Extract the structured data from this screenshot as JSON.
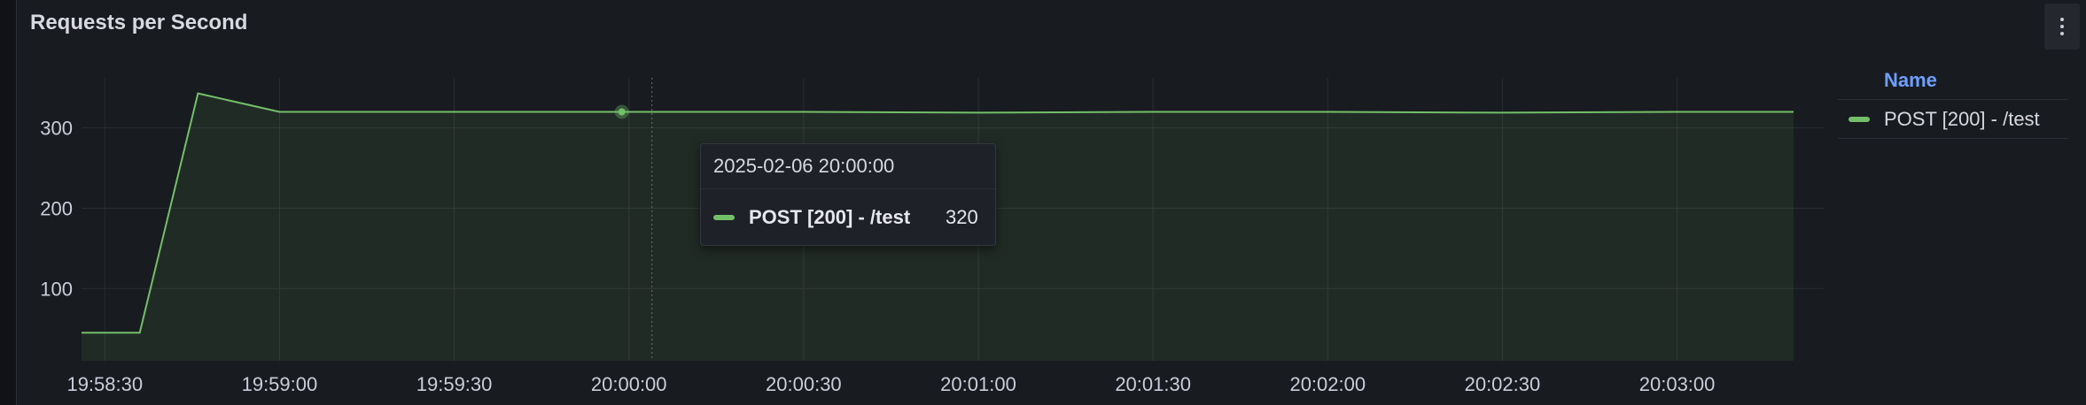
{
  "panel": {
    "title": "Requests per Second"
  },
  "legend": {
    "header": "Name",
    "items": [
      {
        "label": "POST [200] - /test",
        "color": "#73bf69"
      }
    ]
  },
  "tooltip": {
    "time": "2025-02-06 20:00:00",
    "series": "POST [200] - /test",
    "value": "320"
  },
  "chart_data": {
    "type": "area",
    "title": "Requests per Second",
    "xlabel": "",
    "ylabel": "",
    "x_ticks": [
      "19:58:30",
      "19:59:00",
      "19:59:30",
      "20:00:00",
      "20:00:30",
      "20:01:00",
      "20:01:30",
      "20:02:00",
      "20:02:30",
      "20:03:00"
    ],
    "y_ticks": [
      100,
      200,
      300
    ],
    "ylim": [
      10,
      380
    ],
    "xlim": [
      "19:58:26",
      "20:03:20"
    ],
    "grid": true,
    "legend": "right",
    "series": [
      {
        "name": "POST [200] - /test",
        "color": "#73bf69",
        "points": [
          [
            "19:58:26",
            45
          ],
          [
            "19:58:36",
            45
          ],
          [
            "19:58:46",
            343
          ],
          [
            "19:59:00",
            320
          ],
          [
            "19:59:30",
            320
          ],
          [
            "20:00:00",
            320
          ],
          [
            "20:00:30",
            320
          ],
          [
            "20:01:00",
            319
          ],
          [
            "20:01:30",
            320
          ],
          [
            "20:02:00",
            320
          ],
          [
            "20:02:30",
            319
          ],
          [
            "20:03:00",
            320
          ],
          [
            "20:03:20",
            320
          ]
        ]
      }
    ]
  }
}
